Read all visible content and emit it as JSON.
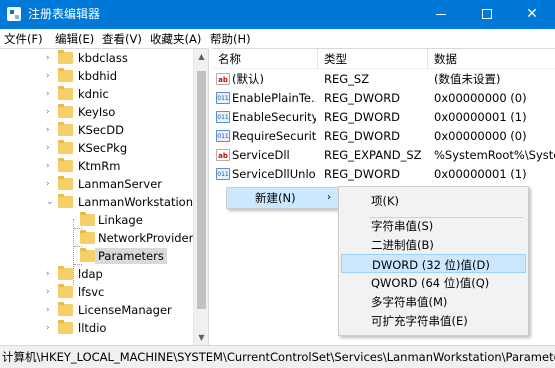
{
  "window": {
    "title": "注册表编辑器",
    "minimize_glyph": "",
    "maximize_glyph": "",
    "close_glyph": "✕"
  },
  "menubar": {
    "items": [
      {
        "label": "文件(F)"
      },
      {
        "label": "编辑(E)"
      },
      {
        "label": "查看(V)"
      },
      {
        "label": "收藏夹(A)"
      },
      {
        "label": "帮助(H)"
      }
    ]
  },
  "tree": {
    "items": [
      {
        "label": "kbdclass",
        "expandable": true
      },
      {
        "label": "kbdhid",
        "expandable": true
      },
      {
        "label": "kdnic",
        "expandable": true
      },
      {
        "label": "KeyIso",
        "expandable": true
      },
      {
        "label": "KSecDD",
        "expandable": true
      },
      {
        "label": "KSecPkg",
        "expandable": true
      },
      {
        "label": "KtmRm",
        "expandable": true
      },
      {
        "label": "LanmanServer",
        "expandable": true
      },
      {
        "label": "LanmanWorkstation",
        "expandable": true,
        "expanded": true
      },
      {
        "label": "Linkage",
        "expandable": false
      },
      {
        "label": "NetworkProvider",
        "expandable": false
      },
      {
        "label": "Parameters",
        "expandable": false,
        "selected": true
      },
      {
        "label": "ldap",
        "expandable": true
      },
      {
        "label": "lfsvc",
        "expandable": true
      },
      {
        "label": "LicenseManager",
        "expandable": true
      },
      {
        "label": "lltdio",
        "expandable": true
      }
    ],
    "expand_glyph": "›",
    "expanded_glyph": "⌄",
    "scroll_up_glyph": "▲",
    "scroll_down_glyph": "▼"
  },
  "list": {
    "headers": {
      "name": "名称",
      "type": "类型",
      "data": "数据"
    },
    "rows": [
      {
        "icon": "string-value-icon",
        "icon_text": "ab",
        "name": "(默认)",
        "type": "REG_SZ",
        "data": "(数值未设置)"
      },
      {
        "icon": "binary-value-icon",
        "icon_text": "011",
        "name": "EnablePlainTe...",
        "type": "REG_DWORD",
        "data": "0x00000000 (0)"
      },
      {
        "icon": "binary-value-icon",
        "icon_text": "011",
        "name": "EnableSecurity...",
        "type": "REG_DWORD",
        "data": "0x00000001 (1)"
      },
      {
        "icon": "binary-value-icon",
        "icon_text": "011",
        "name": "RequireSecurit...",
        "type": "REG_DWORD",
        "data": "0x00000000 (0)"
      },
      {
        "icon": "string-value-icon",
        "icon_text": "ab",
        "name": "ServiceDll",
        "type": "REG_EXPAND_SZ",
        "data": "%SystemRoot%\\System"
      },
      {
        "icon": "binary-value-icon",
        "icon_text": "011",
        "name": "ServiceDllUnlo...",
        "type": "REG_DWORD",
        "data": "0x00000001 (1)"
      }
    ]
  },
  "context_menu": {
    "new_label": "新建(N)",
    "arrow_glyph": "›",
    "submenu": [
      {
        "label": "项(K)"
      },
      {
        "label": "字符串值(S)"
      },
      {
        "label": "二进制值(B)"
      },
      {
        "label": "DWORD (32 位)值(D)",
        "highlighted": true
      },
      {
        "label": "QWORD (64 位)值(Q)"
      },
      {
        "label": "多字符串值(M)"
      },
      {
        "label": "可扩充字符串值(E)"
      }
    ]
  },
  "statusbar": {
    "path": "计算机\\HKEY_LOCAL_MACHINE\\SYSTEM\\CurrentControlSet\\Services\\LanmanWorkstation\\Parameters"
  },
  "colors": {
    "titlebar": "#0078d7",
    "highlight": "#cce8ff",
    "selection_gray": "#d9d9d9",
    "folder": "#f5cf67"
  }
}
